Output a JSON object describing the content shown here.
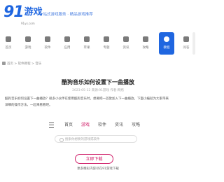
{
  "logo": {
    "number": "91",
    "name": "游戏",
    "subtext": "91yx.com"
  },
  "slogan": "一站式游戏服务 · 精品游戏推荐",
  "categories": [
    {
      "label": "首页",
      "icon": "home-icon"
    },
    {
      "label": "游戏",
      "icon": "gamepad-icon"
    },
    {
      "label": "软件",
      "icon": "apps-icon"
    },
    {
      "label": "应用",
      "icon": "android-icon"
    },
    {
      "label": "苹果",
      "icon": "apple-icon"
    },
    {
      "label": "专题",
      "icon": "grid-icon"
    },
    {
      "label": "资讯",
      "icon": "news-icon"
    },
    {
      "label": "攻略",
      "icon": "guide-icon"
    },
    {
      "label": "教程",
      "icon": "tutorial-icon"
    },
    {
      "label": "问答",
      "icon": "qa-icon",
      "active": true
    }
  ],
  "breadcrumb": "首页 > 软件教程 > 音乐",
  "article": {
    "title": "酷狗音乐如何设置下一曲播放",
    "meta": "2023-05-12 来源:91游戏 作者:网络",
    "paragraph": "酷狗音乐如何设置下一曲播放？很多小伙伴在使用酷狗音乐时，想要把一首歌加入下一曲播放，下面小编就为大家带来详细的操作方法，一起来看看吧。"
  },
  "tabs": [
    "首页",
    "游戏",
    "软件",
    "资讯",
    "攻略"
  ],
  "search_placeholder": "搜索你想要的游戏或软件",
  "download": {
    "button": "立即下载",
    "note": "更多精彩内容尽在91游戏下载"
  }
}
